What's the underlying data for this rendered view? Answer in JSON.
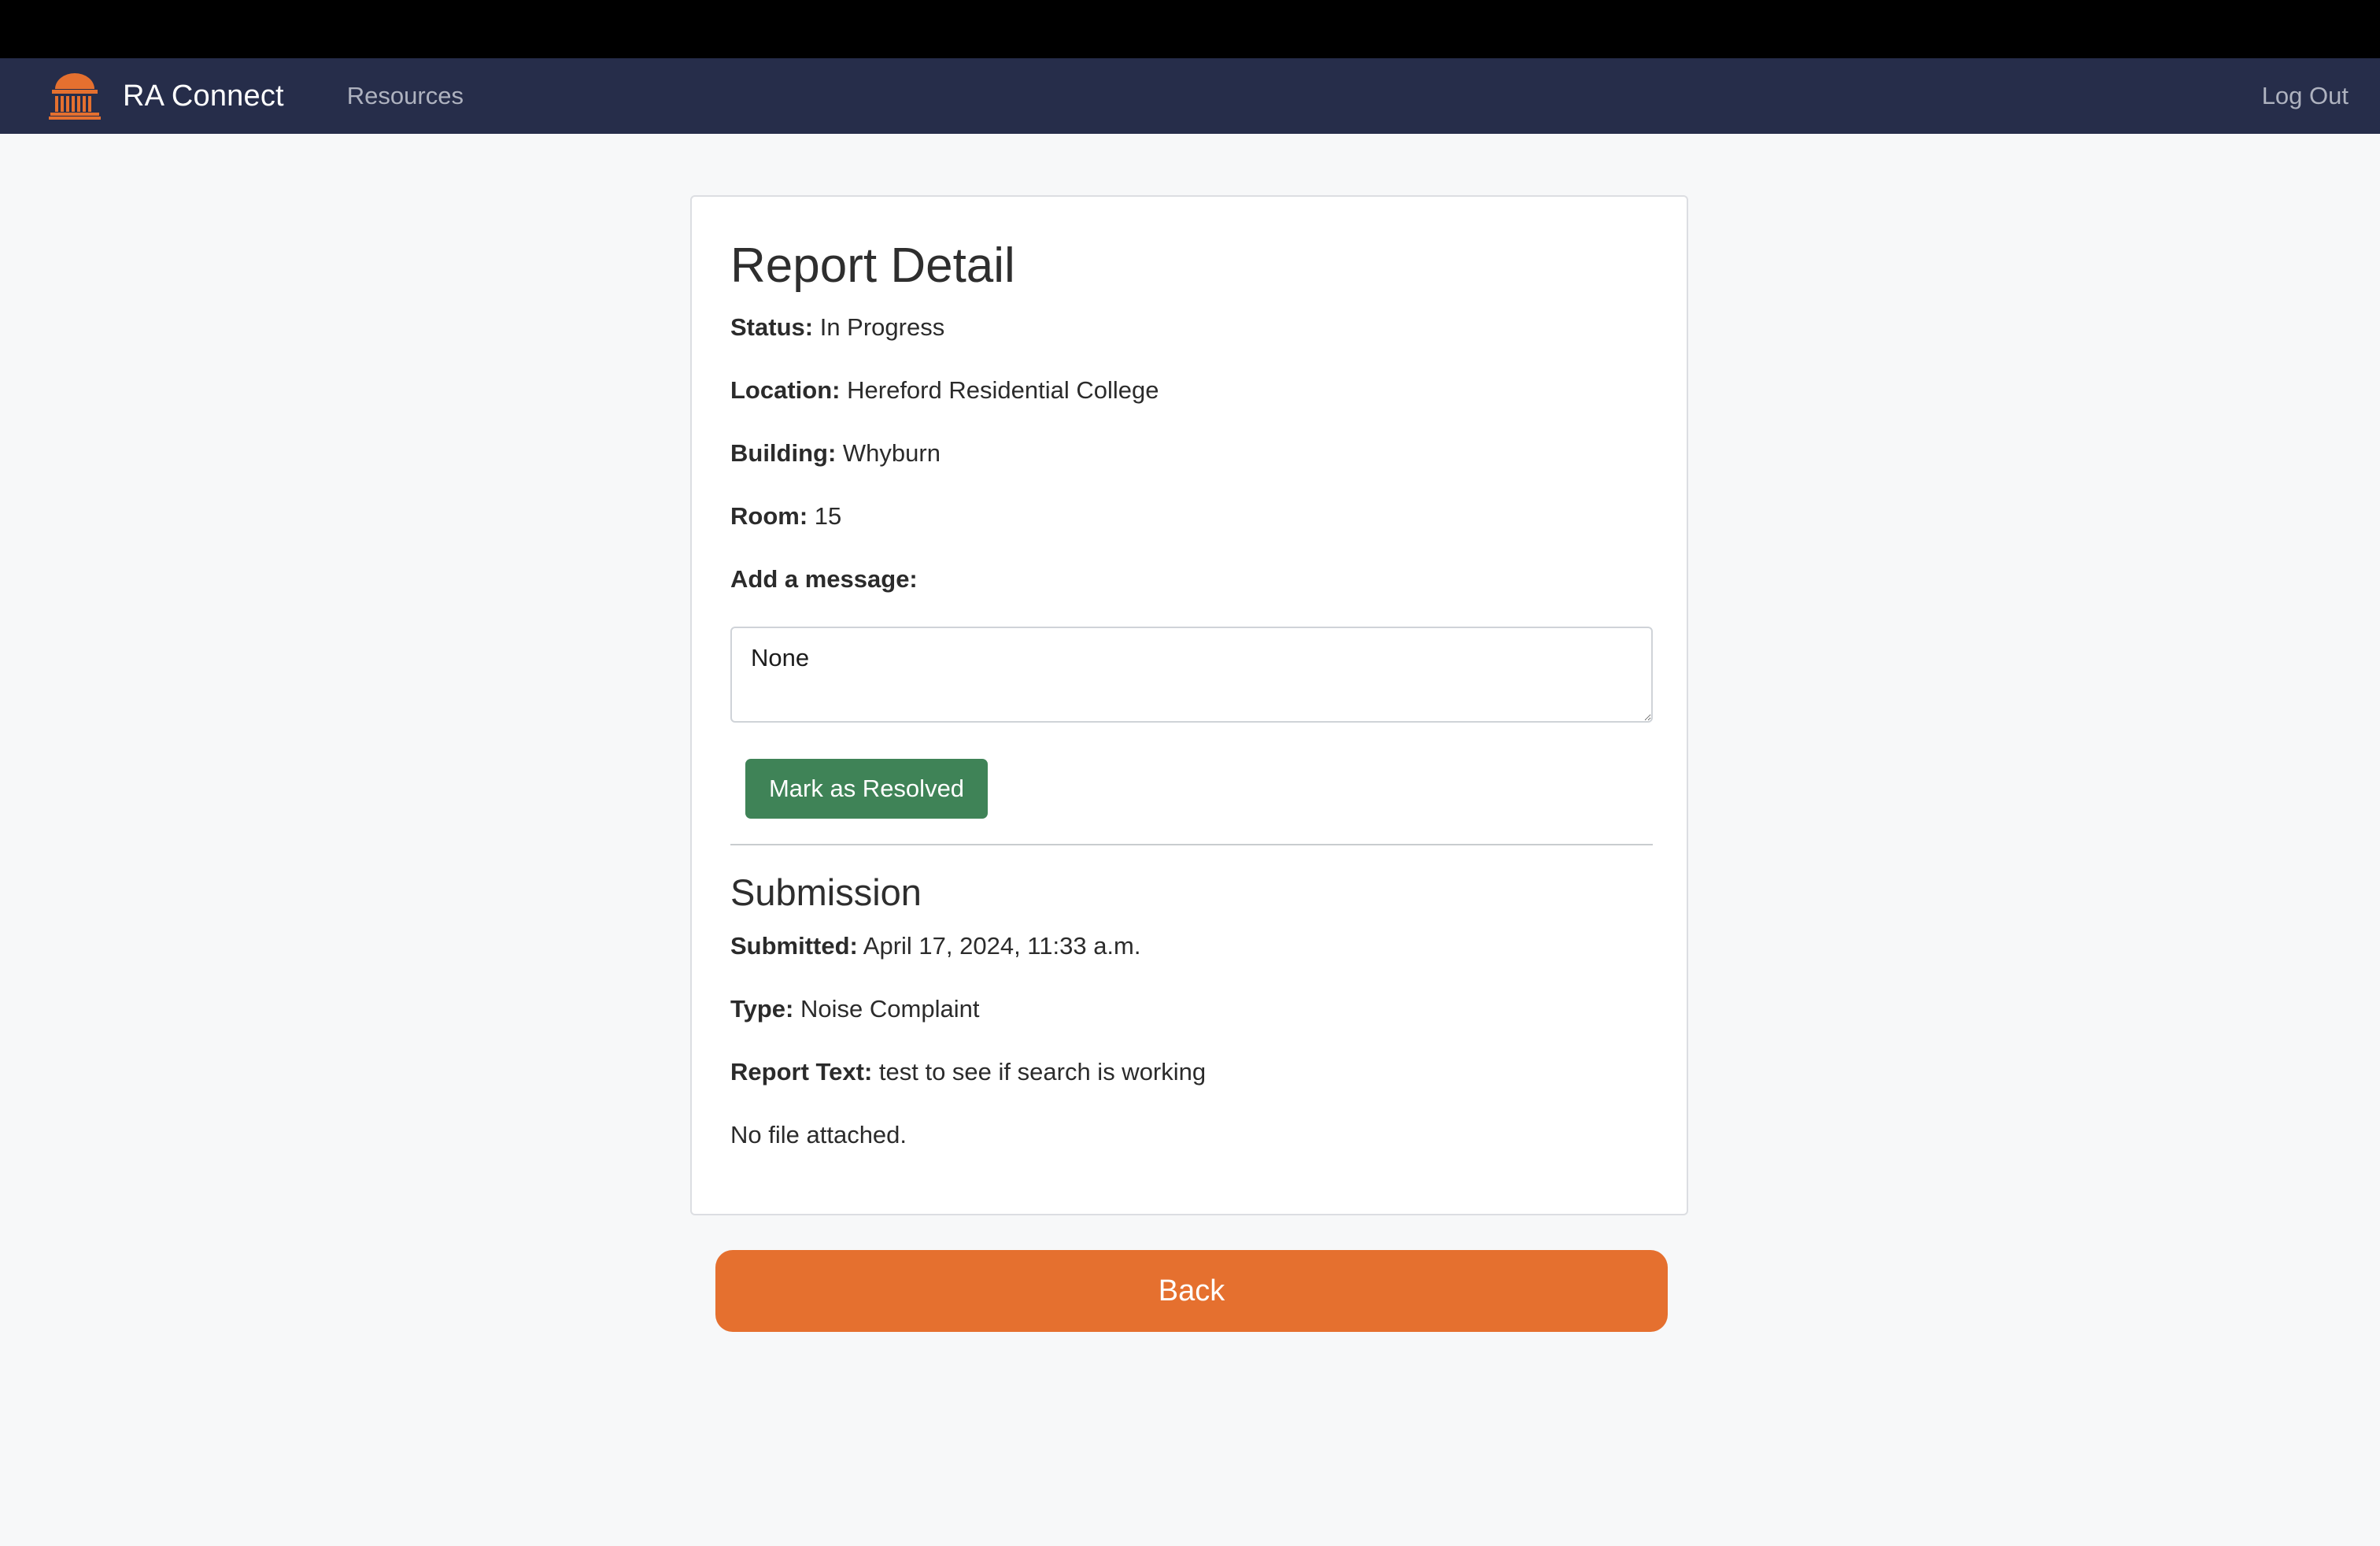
{
  "navbar": {
    "brand": "RA Connect",
    "logo_icon": "rotunda-logo-icon",
    "links": [
      {
        "label": "Resources"
      }
    ],
    "logout": "Log Out"
  },
  "report": {
    "title": "Report Detail",
    "status_label": "Status:",
    "status": "In Progress",
    "location_label": "Location:",
    "location": "Hereford Residential College",
    "building_label": "Building:",
    "building": "Whyburn",
    "room_label": "Room:",
    "room": "15",
    "message_label": "Add a message:",
    "message_value": "None",
    "resolve_button": "Mark as Resolved"
  },
  "submission": {
    "title": "Submission",
    "submitted_label": "Submitted:",
    "submitted": "April 17, 2024, 11:33 a.m.",
    "type_label": "Type:",
    "type": "Noise Complaint",
    "report_text_label": "Report Text:",
    "report_text": "test to see if search is working",
    "file_note": "No file attached."
  },
  "back_button": "Back",
  "colors": {
    "navbar": "#262d4a",
    "brand_orange": "#e5702f",
    "resolve_green": "#3f8357",
    "background": "#f7f8f9"
  }
}
